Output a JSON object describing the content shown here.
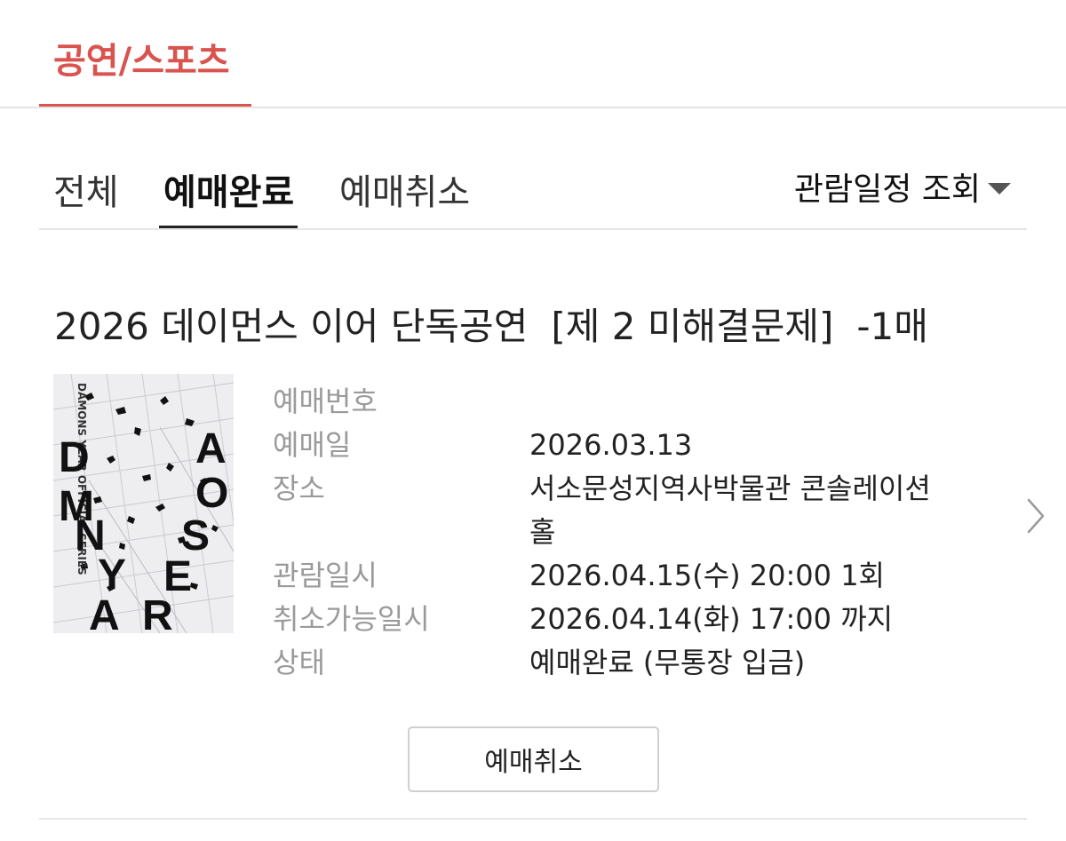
{
  "category_tab": {
    "label": "공연/스포츠"
  },
  "subtabs": {
    "all": "전체",
    "done": "예매완료",
    "cancel": "예매취소",
    "schedule_filter": "관람일정 조회"
  },
  "event": {
    "title": "2026 데이먼스 이어 단독공연",
    "subtitle": "[제 2 미해결문제]",
    "qty": "-1매"
  },
  "details": {
    "reservation_no": {
      "key": "예매번호",
      "value": ""
    },
    "reservation_date": {
      "key": "예매일",
      "value": "2026.03.13"
    },
    "venue": {
      "key": "장소",
      "value_line1": "서소문성지역사박물관 콘솔레이션",
      "value_line2": "홀"
    },
    "show_time": {
      "key": "관람일시",
      "value": "2026.04.15(수) 20:00 1회"
    },
    "cancel_deadline": {
      "key": "취소가능일시",
      "value": "2026.04.14(화) 17:00 까지"
    },
    "status": {
      "key": "상태",
      "value": "예매완료 (무통장 입금)"
    }
  },
  "actions": {
    "cancel_button": "예매취소"
  },
  "poster": {
    "letters": [
      "D",
      "A",
      "M",
      "O",
      "N",
      "S",
      "Y",
      "E",
      "A",
      "R"
    ]
  },
  "colors": {
    "accent": "#d9534f",
    "muted": "#9a9a9a"
  },
  "icons": {
    "filter": "caret-down-icon",
    "row": "chevron-right-icon"
  }
}
